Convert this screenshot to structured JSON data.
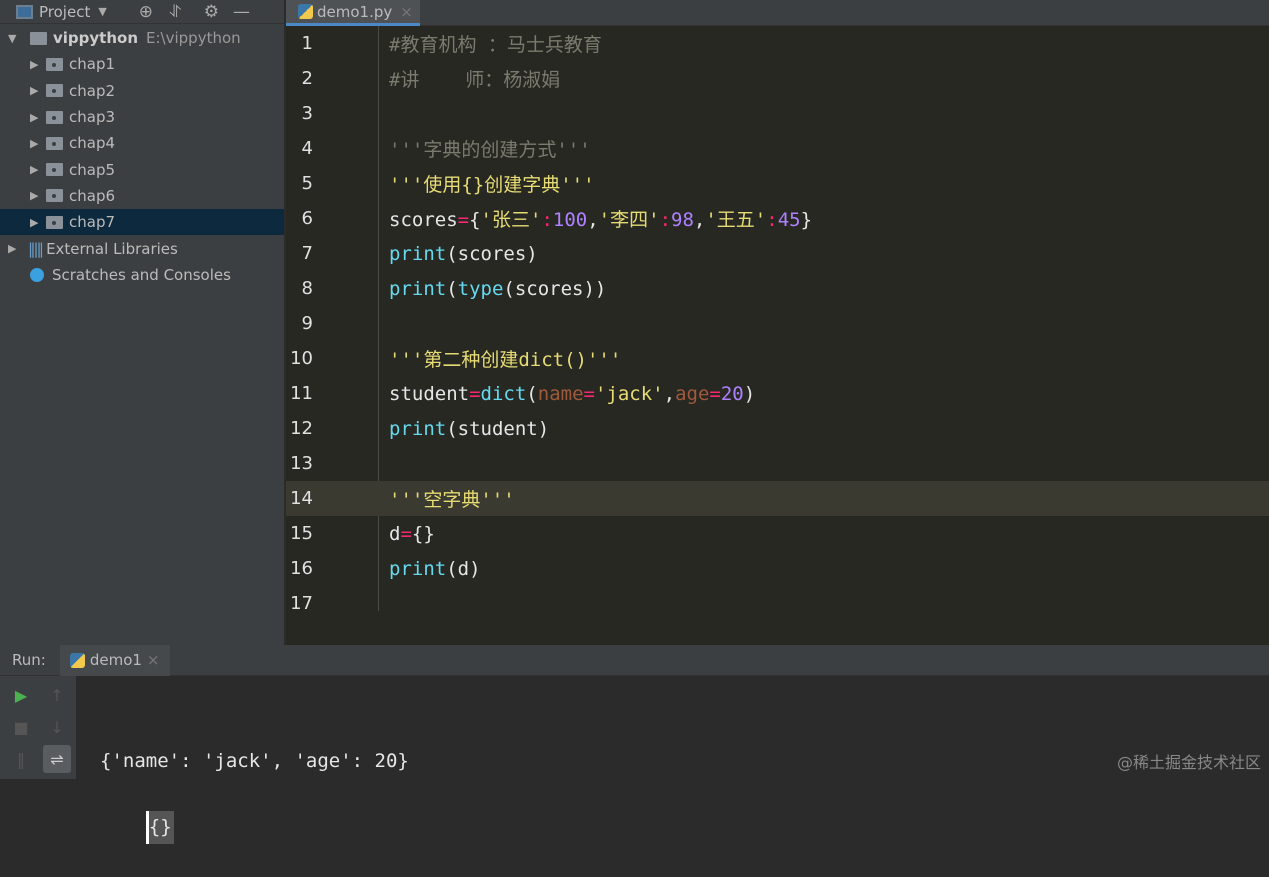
{
  "sidebar": {
    "title": "Project",
    "project_name": "vippython",
    "project_path": "E:\\vippython",
    "folders": [
      "chap1",
      "chap2",
      "chap3",
      "chap4",
      "chap5",
      "chap6",
      "chap7"
    ],
    "selected": "chap7",
    "external": "External Libraries",
    "scratches": "Scratches and Consoles"
  },
  "editor": {
    "tab": "demo1.py",
    "current_line": 14,
    "lines": [
      [
        {
          "t": "#教育机构 ：马士兵教育",
          "c": "cm"
        }
      ],
      [
        {
          "t": "#讲    师：杨淑娟",
          "c": "cm"
        }
      ],
      [],
      [
        {
          "t": "'''字典的创建方式'''",
          "c": "cm"
        }
      ],
      [
        {
          "t": "'''使用{}创建字典'''",
          "c": "str"
        }
      ],
      [
        {
          "t": "scores",
          "c": "def"
        },
        {
          "t": "=",
          "c": "op"
        },
        {
          "t": "{",
          "c": "def"
        },
        {
          "t": "'张三'",
          "c": "str"
        },
        {
          "t": ":",
          "c": "op"
        },
        {
          "t": "100",
          "c": "num"
        },
        {
          "t": ",",
          "c": "def"
        },
        {
          "t": "'李四'",
          "c": "str"
        },
        {
          "t": ":",
          "c": "op"
        },
        {
          "t": "98",
          "c": "num"
        },
        {
          "t": ",",
          "c": "def"
        },
        {
          "t": "'王五'",
          "c": "str"
        },
        {
          "t": ":",
          "c": "op"
        },
        {
          "t": "45",
          "c": "num"
        },
        {
          "t": "}",
          "c": "def"
        }
      ],
      [
        {
          "t": "print",
          "c": "kw"
        },
        {
          "t": "(scores)",
          "c": "def"
        }
      ],
      [
        {
          "t": "print",
          "c": "kw"
        },
        {
          "t": "(",
          "c": "def"
        },
        {
          "t": "type",
          "c": "kw"
        },
        {
          "t": "(scores))",
          "c": "def"
        }
      ],
      [],
      [
        {
          "t": "'''第二种创建dict()'''",
          "c": "str"
        }
      ],
      [
        {
          "t": "student",
          "c": "def"
        },
        {
          "t": "=",
          "c": "op"
        },
        {
          "t": "dict",
          "c": "kw"
        },
        {
          "t": "(",
          "c": "def"
        },
        {
          "t": "name",
          "c": "arg"
        },
        {
          "t": "=",
          "c": "op"
        },
        {
          "t": "'jack'",
          "c": "str"
        },
        {
          "t": ",",
          "c": "def"
        },
        {
          "t": "age",
          "c": "arg"
        },
        {
          "t": "=",
          "c": "op"
        },
        {
          "t": "20",
          "c": "num"
        },
        {
          "t": ")",
          "c": "def"
        }
      ],
      [
        {
          "t": "print",
          "c": "kw"
        },
        {
          "t": "(student)",
          "c": "def"
        }
      ],
      [],
      [
        {
          "t": "'''空字典'''",
          "c": "str"
        }
      ],
      [
        {
          "t": "d",
          "c": "def"
        },
        {
          "t": "=",
          "c": "op"
        },
        {
          "t": "{}",
          "c": "def"
        }
      ],
      [
        {
          "t": "print",
          "c": "kw"
        },
        {
          "t": "(d)",
          "c": "def"
        }
      ],
      []
    ]
  },
  "run": {
    "label": "Run:",
    "tab": "demo1",
    "output": [
      "{'name': 'jack', 'age': 20}",
      "{}"
    ]
  },
  "watermark": "@稀土掘金技术社区"
}
